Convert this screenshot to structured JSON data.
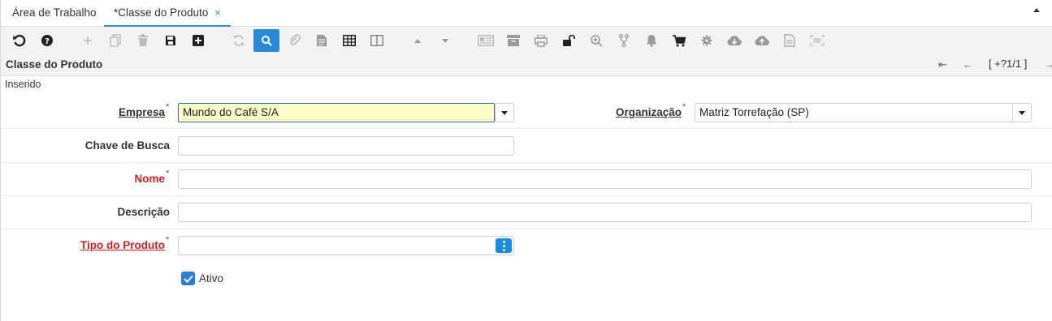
{
  "tabs": {
    "workspace": "Área de Trabalho",
    "active": "*Classe do Produto",
    "close_glyph": "×"
  },
  "toolbar": {
    "icons": [
      "undo-icon",
      "help-icon",
      "new-icon",
      "copy-icon",
      "delete-icon",
      "save-icon",
      "save-new-icon",
      "refresh-icon",
      "find-icon",
      "attachment-icon",
      "chat-icon",
      "grid-toggle-icon",
      "split-view-icon",
      "previous-record-icon",
      "next-record-icon",
      "report-icon",
      "archive-icon",
      "print-icon",
      "lock-icon",
      "zoom-across-icon",
      "workflow-icon",
      "notification-icon",
      "cart-icon",
      "process-icon",
      "download-icon",
      "upload-icon",
      "document-icon",
      "barcode-icon"
    ],
    "active": "find-icon"
  },
  "window": {
    "title": "Classe do Produto",
    "record_count": "[ +?1/1 ]",
    "first_glyph": "⇤",
    "prev_glyph": "←",
    "next_glyph": "→"
  },
  "status": "Inserido",
  "form": {
    "empresa": {
      "label": "Empresa",
      "value": "Mundo do Café S/A"
    },
    "organizacao": {
      "label": "Organização",
      "value": "Matriz Torrefação (SP)"
    },
    "chave": {
      "label": "Chave de Busca",
      "value": ""
    },
    "nome": {
      "label": "Nome",
      "value": ""
    },
    "descricao": {
      "label": "Descrição",
      "value": ""
    },
    "tipo": {
      "label": "Tipo do Produto",
      "value": ""
    },
    "ativo": {
      "label": "Ativo",
      "checked": true
    },
    "required_mark": "*"
  },
  "colors": {
    "accent": "#2a8ad6",
    "required": "#cc1f1f",
    "focus_bg": "#fcfcc8"
  }
}
